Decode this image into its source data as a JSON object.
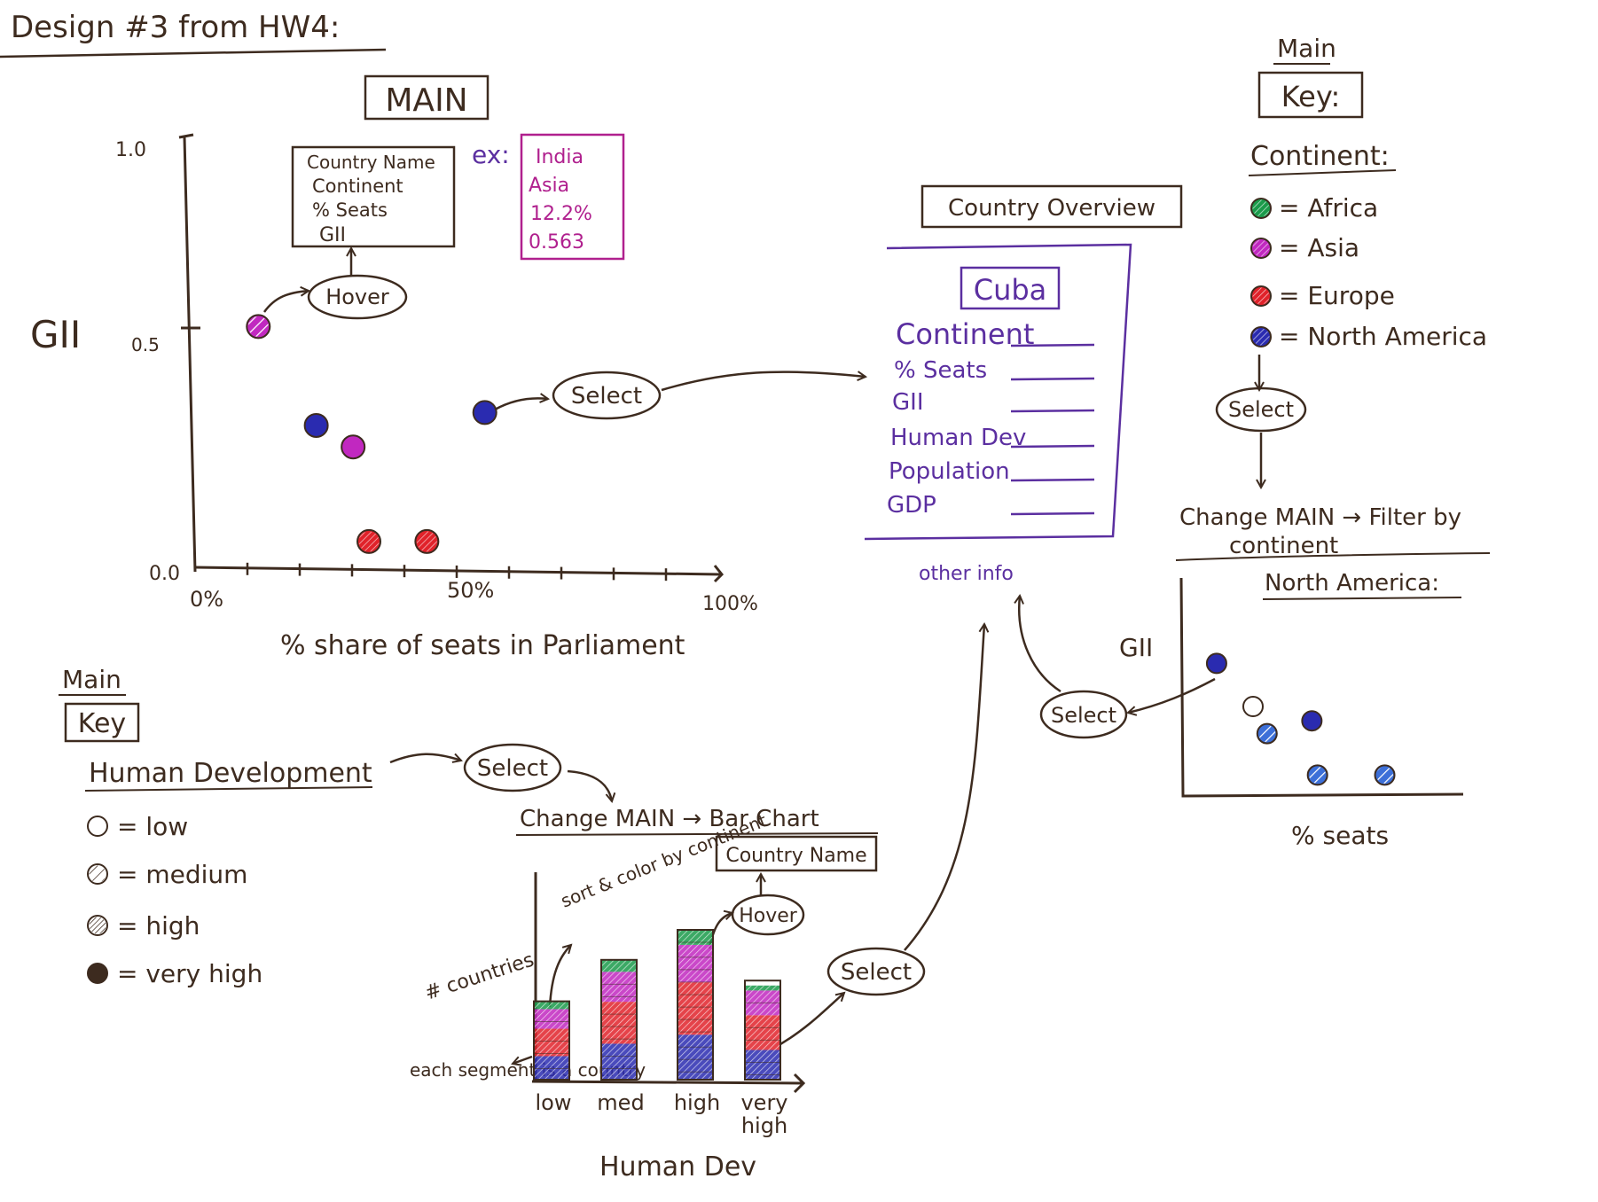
{
  "page_title": "Design #3 from HW4:",
  "colors": {
    "ink": "#3d2b1f",
    "purple_ink": "#5b2fa0",
    "magenta_ink": "#b0208e",
    "africa": "#1a9a4a",
    "asia": "#c128c0",
    "europe": "#e0222a",
    "north_america": "#2a2bb0",
    "na_light": "#3c6fd8"
  },
  "main_scatter": {
    "title": "MAIN",
    "ylabel": "GII",
    "xlabel": "% share of seats in Parliament",
    "y_ticks": [
      "1.0",
      "0.5",
      "0.0"
    ],
    "x_ticks": [
      "0%",
      "50%",
      "100%"
    ],
    "tooltip_fields": [
      "Country Name",
      "Continent",
      "% Seats",
      "GII"
    ],
    "example_prefix": "ex:",
    "example_values": [
      "India",
      "Asia",
      "12.2%",
      "0.563"
    ],
    "hover_label": "Hover",
    "select_label": "Select"
  },
  "chart_data": [
    {
      "type": "scatter",
      "xlabel": "% share of seats in Parliament",
      "ylabel": "GII",
      "xlim": [
        0,
        100
      ],
      "ylim": [
        0,
        1.0
      ],
      "series": [
        {
          "name": "Africa",
          "points": []
        },
        {
          "name": "Asia",
          "points": [
            {
              "x": 12,
              "y": 0.56,
              "hd": "medium"
            },
            {
              "x": 30,
              "y": 0.28,
              "hd": "very high"
            }
          ]
        },
        {
          "name": "Europe",
          "points": [
            {
              "x": 33,
              "y": 0.06,
              "hd": "high"
            },
            {
              "x": 44,
              "y": 0.06,
              "hd": "high"
            }
          ]
        },
        {
          "name": "North America",
          "points": [
            {
              "x": 23,
              "y": 0.33,
              "hd": "very high"
            },
            {
              "x": 55,
              "y": 0.36,
              "hd": "very high"
            }
          ]
        }
      ]
    },
    {
      "type": "bar",
      "xlabel": "Human Dev",
      "ylabel": "# countries",
      "categories": [
        "low",
        "med",
        "high",
        "very high"
      ],
      "values": [
        34,
        52,
        65,
        43
      ],
      "stack_order": [
        "North America",
        "Europe",
        "Asia",
        "Africa"
      ]
    },
    {
      "type": "scatter",
      "xlabel": "% seats",
      "ylabel": "GII",
      "title": "North America:",
      "xlim": [
        0,
        100
      ],
      "ylim": [
        0,
        1.0
      ],
      "points": [
        {
          "x": 12,
          "y": 0.82,
          "hd": "very high"
        },
        {
          "x": 25,
          "y": 0.55,
          "hd": "low"
        },
        {
          "x": 30,
          "y": 0.38,
          "hd": "medium"
        },
        {
          "x": 46,
          "y": 0.46,
          "hd": "very high"
        },
        {
          "x": 48,
          "y": 0.12,
          "hd": "medium"
        },
        {
          "x": 72,
          "y": 0.12,
          "hd": "medium"
        }
      ]
    }
  ],
  "continent_key": {
    "heading": "Main",
    "box_label": "Key:",
    "subtitle": "Continent:",
    "items": [
      {
        "label": "= Africa",
        "color_key": "africa"
      },
      {
        "label": "= Asia",
        "color_key": "asia"
      },
      {
        "label": "= Europe",
        "color_key": "europe"
      },
      {
        "label": "= North America",
        "color_key": "north_america"
      }
    ],
    "select_label": "Select",
    "action_text_line1": "Change MAIN → Filter by",
    "action_text_line2": "continent"
  },
  "country_overview": {
    "title": "Country Overview",
    "country": "Cuba",
    "fields": [
      "Continent",
      "% Seats",
      "GII",
      "Human Dev",
      "Population",
      "GDP"
    ],
    "footer": "other info"
  },
  "hd_key": {
    "heading": "Main",
    "box_label": "Key",
    "subtitle": "Human Development",
    "items": [
      {
        "label": "= low",
        "pattern": "empty"
      },
      {
        "label": "= medium",
        "pattern": "sparse"
      },
      {
        "label": "= high",
        "pattern": "dense"
      },
      {
        "label": "= very high",
        "pattern": "solid"
      }
    ],
    "select_label": "Select",
    "action_text": "Change MAIN → Bar Chart"
  },
  "bar_chart": {
    "annotation_sort": "sort & color by continent",
    "annotation_segment": "each segment is a country",
    "ylabel": "# countries",
    "xlabel": "Human Dev",
    "tooltip": "Country Name",
    "hover_label": "Hover",
    "select_label": "Select"
  },
  "filtered_chart": {
    "title": "North America:",
    "ylabel": "GII",
    "xlabel": "% seats",
    "select_label": "Select"
  }
}
